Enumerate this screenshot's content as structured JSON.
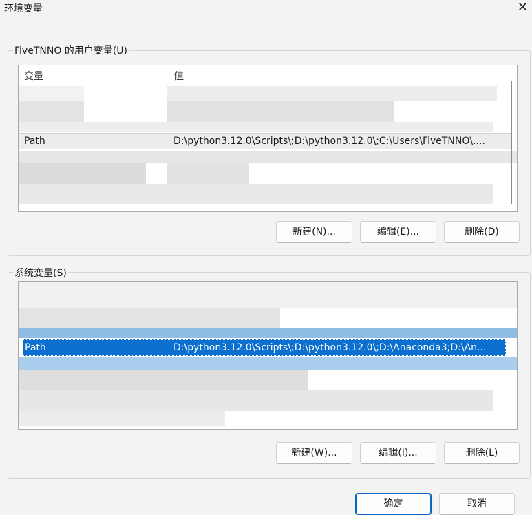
{
  "window": {
    "title": "环境变量",
    "close_glyph": "✕"
  },
  "user_vars": {
    "group_label": "FiveTNNO 的用户变量(U)",
    "columns": [
      "变量",
      "值"
    ],
    "selected_row": {
      "name": "Path",
      "value": "D:\\python3.12.0\\Scripts\\;D:\\python3.12.0\\;C:\\Users\\FiveTNNO\\...."
    },
    "buttons": {
      "new": "新建(N)...",
      "edit": "编辑(E)...",
      "delete": "删除(D)"
    }
  },
  "system_vars": {
    "group_label": "系统变量(S)",
    "selected_row": {
      "name": "Path",
      "value": "D:\\python3.12.0\\Scripts\\;D:\\python3.12.0\\;D:\\Anaconda3;D:\\An..."
    },
    "buttons": {
      "new": "新建(W)...",
      "edit": "编辑(I)...",
      "delete": "删除(L)"
    }
  },
  "footer": {
    "ok": "确定",
    "cancel": "取消"
  },
  "colors": {
    "selection": "#0a6fcf",
    "accent_border": "#0a66c2"
  }
}
